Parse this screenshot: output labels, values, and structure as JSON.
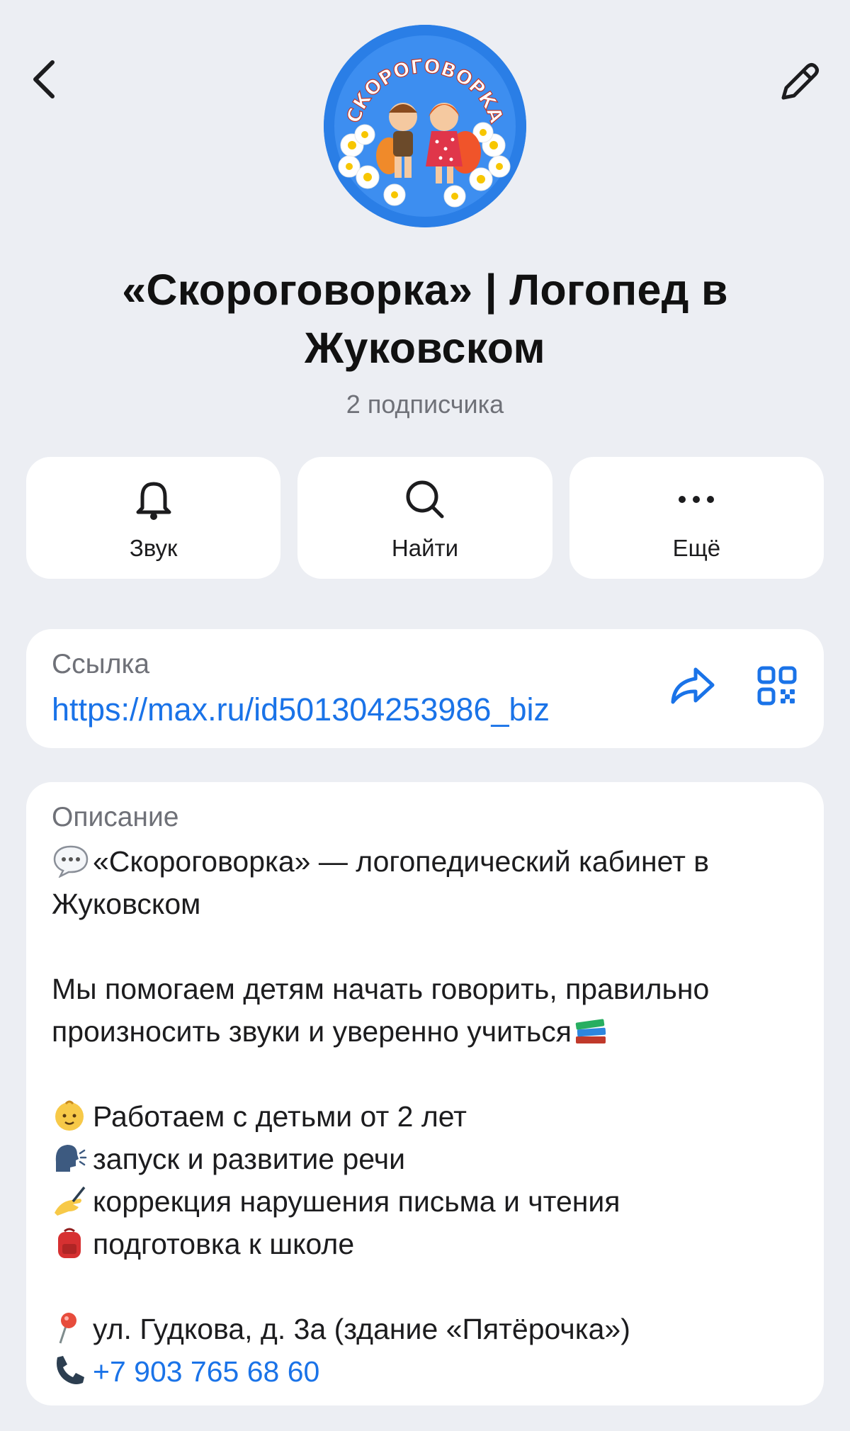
{
  "header": {
    "back_icon": "chevron-left-icon",
    "edit_icon": "pencil-icon",
    "avatar_logo_text": "СКОРОГОВОРКА"
  },
  "channel": {
    "title_line1": "«Скороговорка» | Логопед в",
    "title_line2": "Жуковском",
    "subscribers": "2 подписчика"
  },
  "actions": [
    {
      "label": "Звук",
      "icon": "bell-icon"
    },
    {
      "label": "Найти",
      "icon": "search-icon"
    },
    {
      "label": "Ещё",
      "icon": "more-dots-icon"
    }
  ],
  "link": {
    "caption": "Ссылка",
    "url": "https://max.ru/id501304253986_biz",
    "share_icon": "share-arrow-icon",
    "qr_icon": "qr-code-icon"
  },
  "description": {
    "caption": "Описание",
    "line1": "«Скороговорка» — логопедический кабинет в",
    "line2": "Жуковском",
    "line3": "Мы помогаем детям начать говорить, правильно",
    "line4": "произносить звуки и уверенно учиться",
    "item1": "Работаем с детьми от 2 лет",
    "item2": "запуск и развитие речи",
    "item3": "коррекция нарушения письма и чтения",
    "item4": "подготовка к школе",
    "address": "ул. Гудкова, д. 3а (здание «Пятёрочка»)",
    "phone": "+7 903 765 68 60",
    "emoji_icons": [
      "speech-bubble-icon",
      "books-icon",
      "baby-icon",
      "speaking-head-icon",
      "writing-hand-icon",
      "backpack-icon",
      "pin-icon",
      "telephone-icon"
    ]
  },
  "colors": {
    "background": "#eceef3",
    "card": "#ffffff",
    "link": "#1a73e8",
    "secondary_text": "#6f7178",
    "avatar": "#2a7ee6"
  }
}
